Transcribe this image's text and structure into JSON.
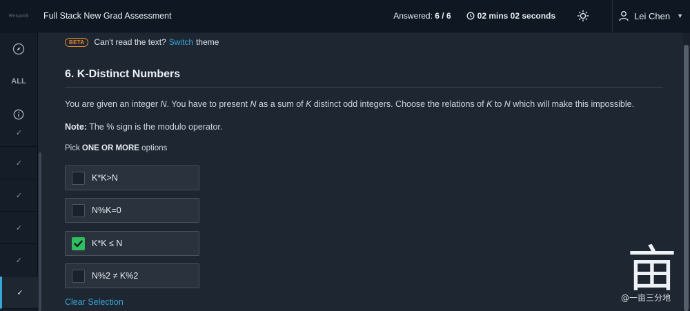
{
  "header": {
    "logo_text": "Respark",
    "app_title": "Full Stack New Grad Assessment",
    "answered_label": "Answered:",
    "answered_value": "6 / 6",
    "timer": "02 mins 02 seconds",
    "user_name": "Lei Chen"
  },
  "sidebar": {
    "all_label": "ALL",
    "items": [
      "✓",
      "✓",
      "✓",
      "✓",
      "✓",
      "✓"
    ]
  },
  "banner": {
    "badge": "BETA",
    "text_before": "Can't read the text?",
    "link": "Switch",
    "text_after": "theme"
  },
  "question": {
    "title": "6. K-Distinct Numbers",
    "text_parts": [
      "You are given an integer ",
      "N",
      ". You have to present ",
      "N",
      " as a sum of ",
      "K",
      " distinct odd integers. Choose the relations of ",
      "K",
      " to ",
      "N",
      " which will make this impossible."
    ],
    "note_label": "Note:",
    "note_text": " The % sign is the modulo operator.",
    "pick_prefix": "Pick ",
    "pick_bold": "ONE OR MORE",
    "pick_suffix": " options",
    "options": [
      {
        "label": "K*K>N",
        "checked": false
      },
      {
        "label": "N%K=0",
        "checked": false
      },
      {
        "label": "K*K ≤ N",
        "checked": true
      },
      {
        "label": "N%2 ≠ K%2",
        "checked": false
      }
    ],
    "clear_label": "Clear Selection"
  },
  "watermark": {
    "text": "@一亩三分地",
    "glyph": "亩"
  },
  "colors": {
    "accent": "#39a6d8",
    "check": "#2ebd5f",
    "beta": "#e8892d"
  }
}
